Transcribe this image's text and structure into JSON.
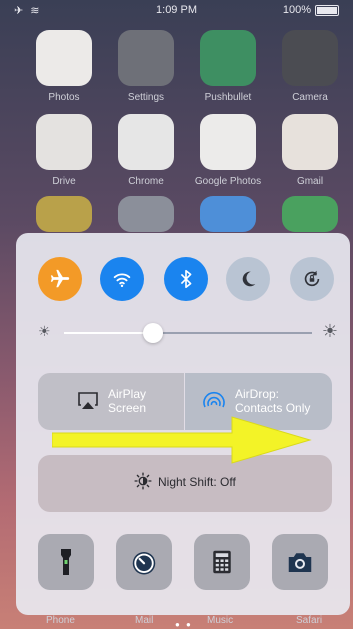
{
  "status": {
    "left": "✈ ≋",
    "time": "1:09 PM",
    "battery_text": "100%"
  },
  "home_apps": [
    {
      "label": "Photos"
    },
    {
      "label": "Settings"
    },
    {
      "label": "Pushbullet"
    },
    {
      "label": "Camera"
    },
    {
      "label": "Drive"
    },
    {
      "label": "Chrome"
    },
    {
      "label": "Google Photos"
    },
    {
      "label": "Gmail"
    }
  ],
  "control_center": {
    "toggles": [
      {
        "icon": "airplane-icon",
        "state": "on",
        "color": "#f39a27"
      },
      {
        "icon": "wifi-icon",
        "state": "on",
        "color": "#1a84ef"
      },
      {
        "icon": "bluetooth-icon",
        "state": "on",
        "color": "#1a84ef"
      },
      {
        "icon": "moon-icon",
        "state": "off",
        "color": "#b9c4d3"
      },
      {
        "icon": "rotation-lock-icon",
        "state": "off",
        "color": "#b9c4d3"
      }
    ],
    "brightness_fraction": 0.36,
    "airplay": {
      "line1": "AirPlay",
      "line2": "Screen"
    },
    "airdrop": {
      "line1": "AirDrop:",
      "line2": "Contacts Only"
    },
    "night_shift": "Night Shift: Off",
    "tools": [
      "flashlight-icon",
      "timer-icon",
      "calculator-icon",
      "camera-icon"
    ]
  },
  "dock": {
    "labels": [
      "Phone",
      "Mail",
      "Music",
      "Safari"
    ]
  },
  "annotation_color": "#f3f327"
}
